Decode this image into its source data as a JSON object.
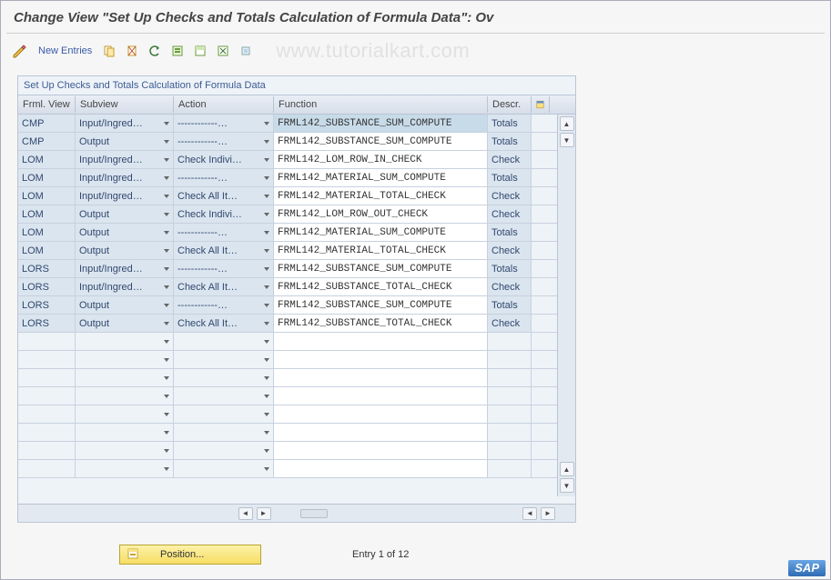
{
  "title": "Change View \"Set Up Checks and Totals Calculation of Formula Data\": Ov",
  "toolbar": {
    "new_entries": "New Entries"
  },
  "watermark": "www.tutorialkart.com",
  "panel": {
    "title": "Set Up Checks and Totals Calculation of Formula Data",
    "headers": {
      "frml_view": "Frml. View",
      "subview": "Subview",
      "action": "Action",
      "function": "Function",
      "descr": "Descr."
    },
    "rows": [
      {
        "frml": "CMP",
        "sub": "Input/Ingred…",
        "action": "------------…",
        "func": "FRML142_SUBSTANCE_SUM_COMPUTE",
        "descr": "Totals",
        "funcSelected": true
      },
      {
        "frml": "CMP",
        "sub": "Output",
        "action": "------------…",
        "func": "FRML142_SUBSTANCE_SUM_COMPUTE",
        "descr": "Totals"
      },
      {
        "frml": "LOM",
        "sub": "Input/Ingred…",
        "action": "Check Indivi…",
        "func": "FRML142_LOM_ROW_IN_CHECK",
        "descr": "Check"
      },
      {
        "frml": "LOM",
        "sub": "Input/Ingred…",
        "action": "------------…",
        "func": "FRML142_MATERIAL_SUM_COMPUTE",
        "descr": "Totals"
      },
      {
        "frml": "LOM",
        "sub": "Input/Ingred…",
        "action": "Check All It…",
        "func": "FRML142_MATERIAL_TOTAL_CHECK",
        "descr": "Check"
      },
      {
        "frml": "LOM",
        "sub": "Output",
        "action": "Check Indivi…",
        "func": "FRML142_LOM_ROW_OUT_CHECK",
        "descr": "Check"
      },
      {
        "frml": "LOM",
        "sub": "Output",
        "action": "------------…",
        "func": "FRML142_MATERIAL_SUM_COMPUTE",
        "descr": "Totals"
      },
      {
        "frml": "LOM",
        "sub": "Output",
        "action": "Check All It…",
        "func": "FRML142_MATERIAL_TOTAL_CHECK",
        "descr": "Check"
      },
      {
        "frml": "LORS",
        "sub": "Input/Ingred…",
        "action": "------------…",
        "func": "FRML142_SUBSTANCE_SUM_COMPUTE",
        "descr": "Totals"
      },
      {
        "frml": "LORS",
        "sub": "Input/Ingred…",
        "action": "Check All It…",
        "func": "FRML142_SUBSTANCE_TOTAL_CHECK",
        "descr": "Check"
      },
      {
        "frml": "LORS",
        "sub": "Output",
        "action": "------------…",
        "func": "FRML142_SUBSTANCE_SUM_COMPUTE",
        "descr": "Totals"
      },
      {
        "frml": "LORS",
        "sub": "Output",
        "action": "Check All It…",
        "func": "FRML142_SUBSTANCE_TOTAL_CHECK",
        "descr": "Check"
      }
    ],
    "empty_rows": 8
  },
  "footer": {
    "position": "Position...",
    "entry": "Entry 1 of 12"
  },
  "logo": "SAP"
}
